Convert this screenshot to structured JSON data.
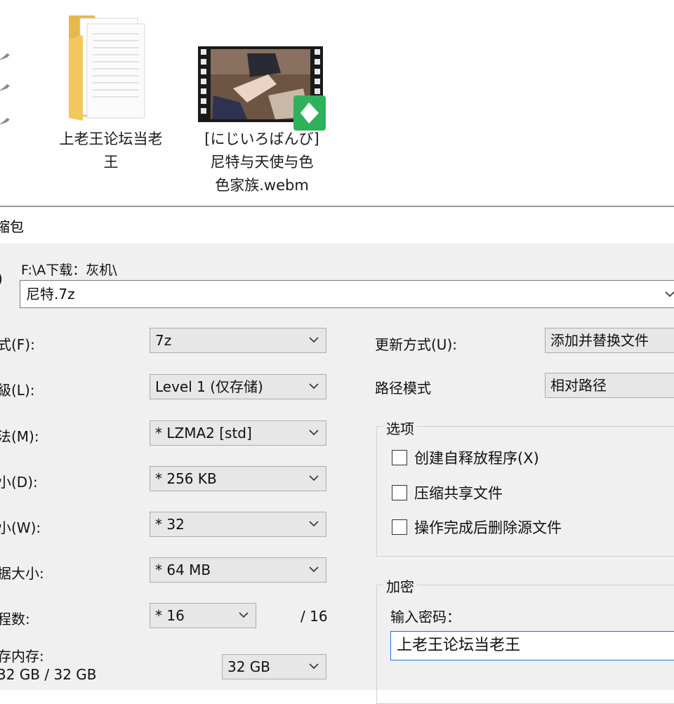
{
  "explorer": {
    "items": [
      {
        "name_line1": "上老王论坛当老",
        "name_line2": "王",
        "type": "folder",
        "icon": "folder-icon"
      },
      {
        "name_line1": "[にじいろばんび]",
        "name_line2": "尼特与天使与色",
        "name_line3": "色家族.webm",
        "type": "video",
        "icon": "video-thumbnail-icon"
      }
    ]
  },
  "dialog": {
    "title": "缩包",
    "archive": {
      "label": ")",
      "path": "F:\\A下载：灰机\\",
      "value": "尼特.7z"
    },
    "left": {
      "format": {
        "label": "式(F):",
        "value": "7z"
      },
      "level": {
        "label": "級(L):",
        "value": "Level 1 (仅存储)"
      },
      "method": {
        "label": "法(M):",
        "value": "*  LZMA2 [std]"
      },
      "dict": {
        "label": "小(D):",
        "value": "*  256 KB"
      },
      "word": {
        "label": "小(W):",
        "value": "*  32"
      },
      "solid": {
        "label": "据大小:",
        "value": "*  64 MB"
      },
      "threads": {
        "label": "程数:",
        "value": "*  16",
        "max": "/ 16"
      },
      "memory": {
        "label": "存内存:",
        "sub": "32 GB / 32 GB",
        "value": "32 GB"
      }
    },
    "right": {
      "update": {
        "label": "更新方式(U):",
        "value": "添加并替换文件"
      },
      "path_mode": {
        "label": "路径模式",
        "value": "相对路径"
      },
      "options": {
        "title": "选项",
        "items": [
          "创建自释放程序(X)",
          "压缩共享文件",
          "操作完成后删除源文件"
        ]
      },
      "encryption": {
        "title": "加密",
        "password_label": "输入密码：",
        "password_value": "上老王论坛当老王"
      }
    }
  },
  "colors": {
    "dialog_bg": "#f0f0f0",
    "combo_bg": "#e7e7e7",
    "focus_border": "#2a6ec8"
  }
}
